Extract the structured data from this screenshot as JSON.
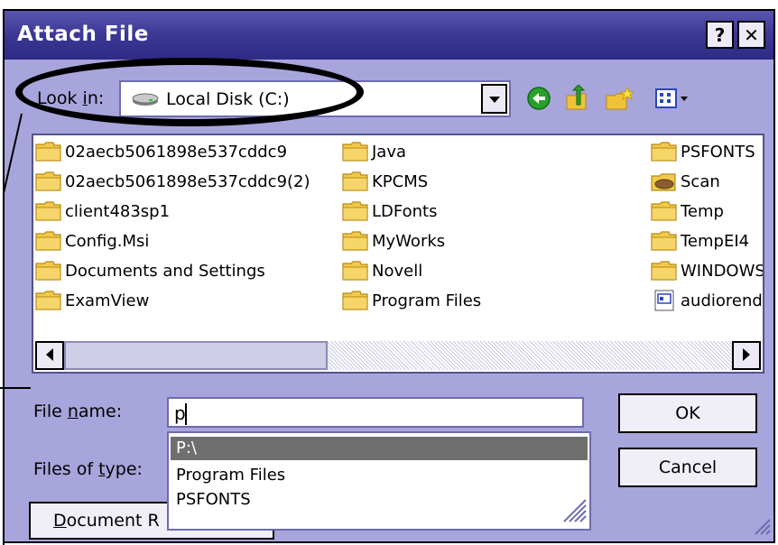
{
  "dialog": {
    "title": "Attach File"
  },
  "titlebar": {
    "help": "?",
    "close": "✕"
  },
  "lookin": {
    "label_pre": "Look ",
    "label_key": "i",
    "label_post": "n:",
    "value": "Local Disk (C:)"
  },
  "toolbar": {
    "icons": [
      "back-icon",
      "up-folder-icon",
      "new-folder-icon",
      "view-menu-icon"
    ]
  },
  "files": {
    "col1": [
      "02aecb5061898e537cddc9",
      "02aecb5061898e537cddc9(2)",
      "client483sp1",
      "Config.Msi",
      "Documents and Settings",
      "ExamView"
    ],
    "col2": [
      "Java",
      "KPCMS",
      "LDFonts",
      "MyWorks",
      "Novell",
      "Program Files"
    ],
    "col3": [
      "PSFONTS",
      "Scan",
      "Temp",
      "TempEI4",
      "WINDOWS",
      "audiorenderer"
    ]
  },
  "filename": {
    "label_pre": "File ",
    "label_key": "n",
    "label_post": "ame:",
    "value": "p"
  },
  "filetype": {
    "label_pre": "Files of ",
    "label_key": "t",
    "label_post": "ype:"
  },
  "autocomplete": [
    "P:\\",
    "Program Files",
    "PSFONTS"
  ],
  "buttons": {
    "ok": "OK",
    "cancel": "Cancel",
    "doc_key": "D",
    "doc_rest": "ocument R"
  },
  "colors": {
    "dialog_bg": "#a8a5dc",
    "titlebar": "#3b3794",
    "selection": "#6f6f6f"
  }
}
